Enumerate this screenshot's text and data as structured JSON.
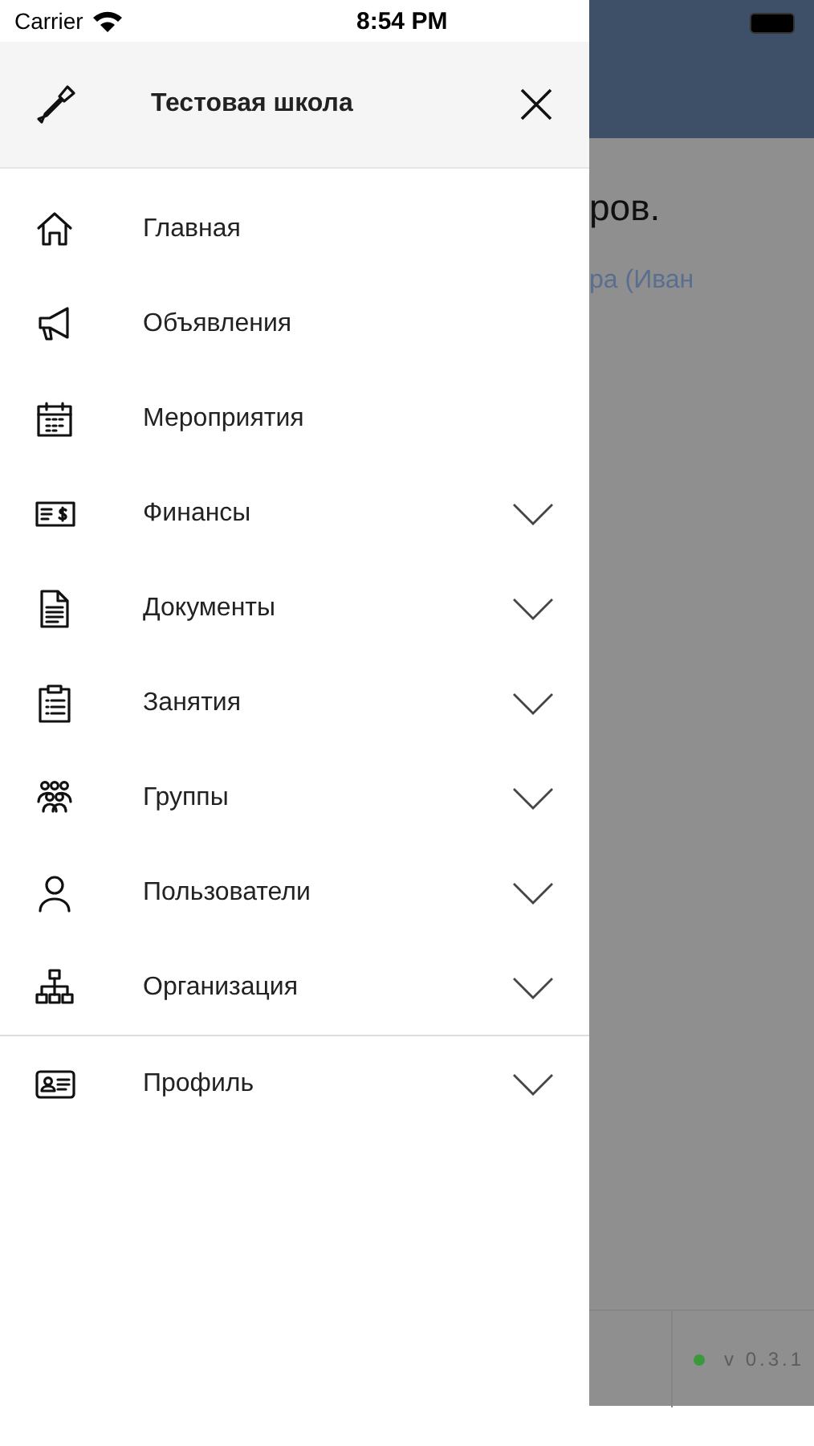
{
  "status_bar": {
    "carrier": "Carrier",
    "time": "8:54 PM"
  },
  "drawer": {
    "title": "Тестовая школа",
    "menu": [
      {
        "label": "Главная",
        "expandable": false
      },
      {
        "label": "Объявления",
        "expandable": false
      },
      {
        "label": "Мероприятия",
        "expandable": false
      },
      {
        "label": "Финансы",
        "expandable": true
      },
      {
        "label": "Документы",
        "expandable": true
      },
      {
        "label": "Занятия",
        "expandable": true
      },
      {
        "label": "Группы",
        "expandable": true
      },
      {
        "label": "Пользователи",
        "expandable": true
      },
      {
        "label": "Организация",
        "expandable": true
      }
    ],
    "bottom_menu": [
      {
        "label": "Профиль",
        "expandable": true
      }
    ]
  },
  "background": {
    "heading": "ров.",
    "subtitle": "ра (Иван",
    "version": "v 0.3.1",
    "status_dot": {
      "color": "#3a9a3a"
    }
  }
}
